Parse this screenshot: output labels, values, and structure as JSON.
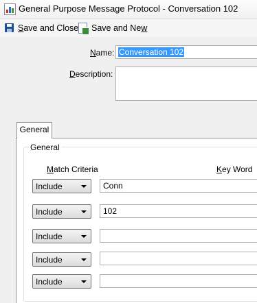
{
  "window": {
    "title": "General Purpose Message Protocol  -  Conversation 102",
    "icon": "chart-app-icon"
  },
  "toolbar": {
    "save_close": {
      "pre": "",
      "accel": "S",
      "post": "ave and Close",
      "icon": "save-icon"
    },
    "save_new": {
      "pre": "Save and Ne",
      "accel": "w",
      "post": "",
      "icon": "save-new-icon"
    }
  },
  "form": {
    "name_label": {
      "accel": "N",
      "post": "ame:"
    },
    "name_value": "Conversation 102",
    "description_label": {
      "accel": "D",
      "post": "escription:"
    },
    "description_value": ""
  },
  "tabs": [
    {
      "label": "General",
      "selected": true
    }
  ],
  "group": {
    "title": "General",
    "match_header": {
      "accel": "M",
      "post": "atch Criteria"
    },
    "keyword_header": {
      "accel": "K",
      "post": "ey Word"
    },
    "rows": [
      {
        "match": "Include",
        "keyword": "Conn"
      },
      {
        "match": "Include",
        "keyword": "102"
      },
      {
        "match": "Include",
        "keyword": ""
      },
      {
        "match": "Include",
        "keyword": ""
      },
      {
        "match": "Include",
        "keyword": ""
      }
    ]
  },
  "colors": {
    "selection": "#3399ff",
    "save_icon": "#1f4e99"
  }
}
